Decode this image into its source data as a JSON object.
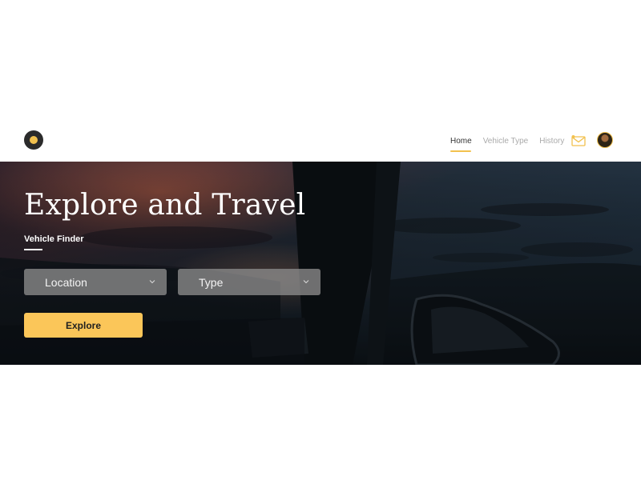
{
  "navbar": {
    "links": [
      {
        "label": "Home",
        "active": true
      },
      {
        "label": "Vehicle Type",
        "active": false
      },
      {
        "label": "History",
        "active": false
      }
    ],
    "icons": {
      "logo": "logo-icon",
      "mail": "mail-icon",
      "avatar": "avatar"
    }
  },
  "hero": {
    "title": "Explore and Travel",
    "subtitle": "Vehicle Finder",
    "location_select": "Location",
    "type_select": "Type",
    "explore_button": "Explore"
  },
  "colors": {
    "accent": "#fbc659",
    "hero_overlay": "#1f2a32",
    "text_muted": "#aaaaaa",
    "text_dark": "#333333"
  }
}
